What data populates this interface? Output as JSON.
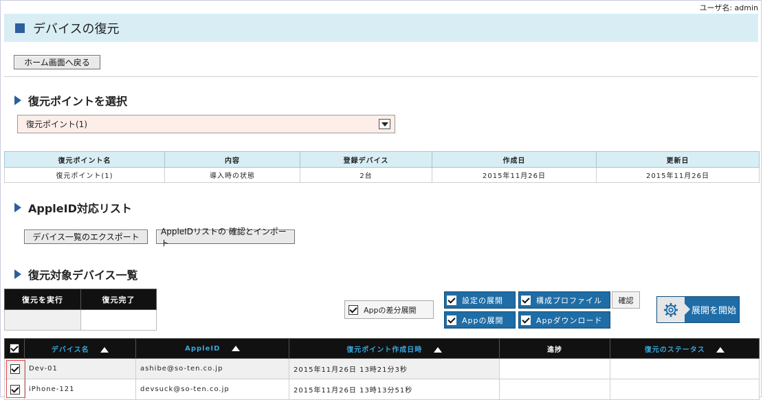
{
  "header": {
    "username_label": "ユーザ名: admin",
    "title": "デバイスの復元"
  },
  "nav": {
    "home_button": "ホーム画面へ戻る"
  },
  "restore_point": {
    "section_title": "復元ポイントを選択",
    "selected": "復元ポイント(1)",
    "table": {
      "headers": [
        "復元ポイント名",
        "内容",
        "登録デバイス",
        "作成日",
        "更新日"
      ],
      "row": [
        "復元ポイント(1)",
        "導入時の状態",
        "2台",
        "2015年11月26日",
        "2015年11月26日"
      ]
    }
  },
  "appleid": {
    "section_title": "AppleID対応リスト",
    "export_button": "デバイス一覧のエクスポート",
    "import_button": "AppleIDリストの 確認とインポート"
  },
  "devices": {
    "section_title": "復元対象デバイス一覧",
    "status_headers": [
      "復元を実行",
      "復元完了"
    ],
    "diff_option": "Appの差分展開",
    "options": {
      "settings": "設定の展開",
      "profile": "構成プロファイル",
      "app": "Appの展開",
      "app_download": "Appダウンロード"
    },
    "confirm_button": "確認",
    "start_button": "展開を開始",
    "table": {
      "headers": [
        "デバイス名",
        "AppleID",
        "復元ポイント作成日時",
        "進捗",
        "復元のステータス"
      ],
      "rows": [
        {
          "name": "Dev-01",
          "appleid": "ashibe@so-ten.co.jp",
          "created": "2015年11月26日  13時21分3秒",
          "progress": "",
          "status": ""
        },
        {
          "name": "iPhone-121",
          "appleid": "devsuck@so-ten.co.jp",
          "created": "2015年11月26日  13時13分51秒",
          "progress": "",
          "status": ""
        }
      ]
    }
  },
  "colors": {
    "accent": "#2c5f9e",
    "title_bg": "#d8eef4",
    "option_blue": "#1f6da6",
    "header_link": "#36a7de"
  }
}
